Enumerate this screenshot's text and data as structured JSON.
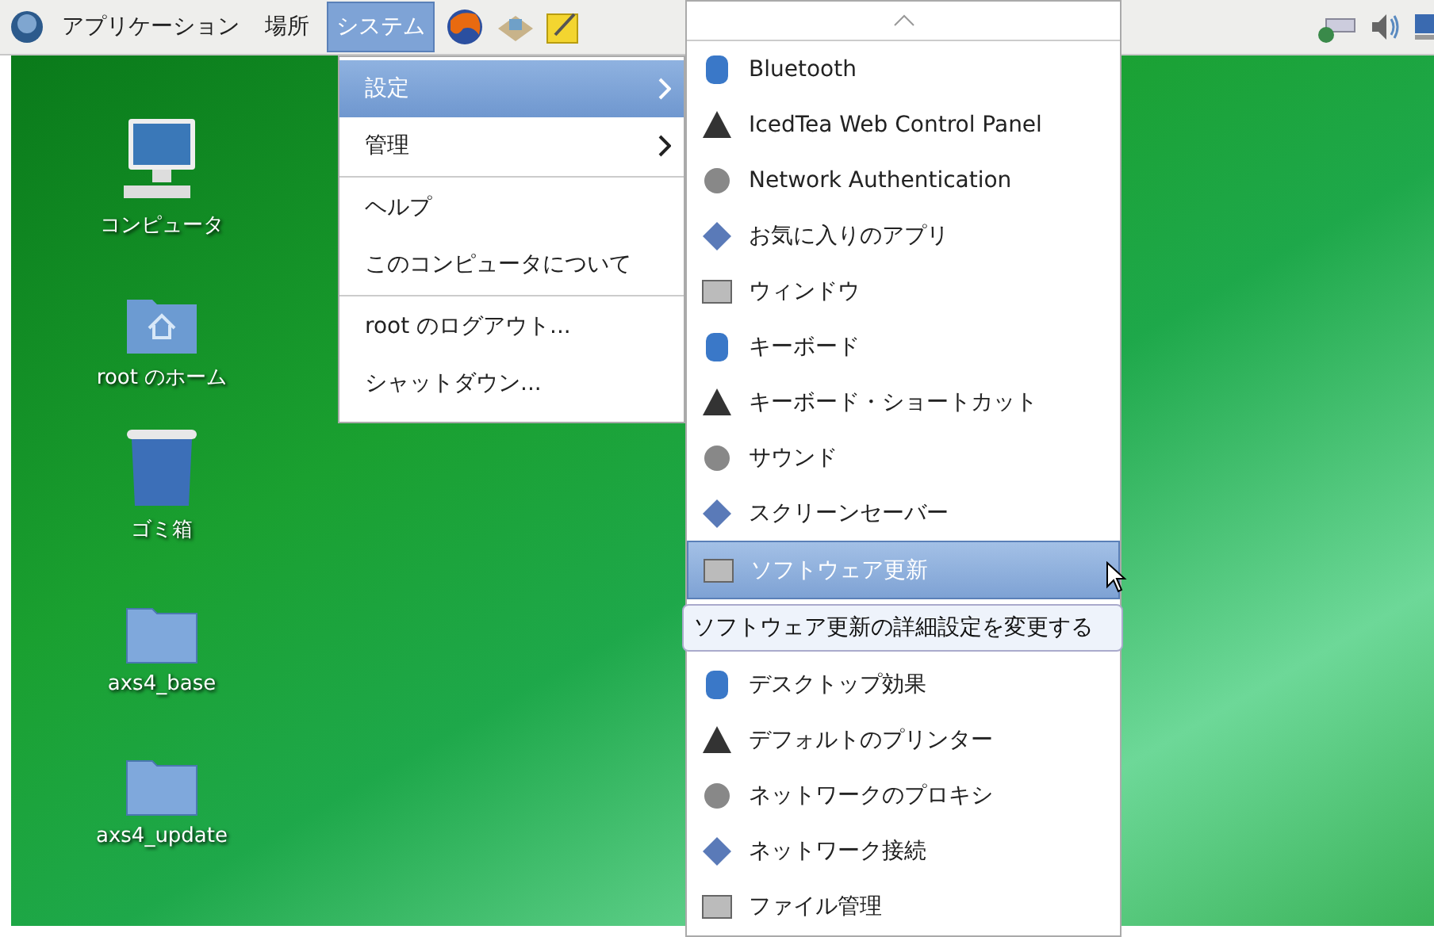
{
  "panel": {
    "menus": [
      {
        "label": "アプリケーション",
        "selected": false
      },
      {
        "label": "場所",
        "selected": false
      },
      {
        "label": "システム",
        "selected": true
      }
    ]
  },
  "desktop_icons": [
    {
      "kind": "computer",
      "label": "コンピュータ"
    },
    {
      "kind": "home",
      "label": "root のホーム"
    },
    {
      "kind": "trash",
      "label": "ゴミ箱"
    },
    {
      "kind": "folder",
      "label": "axs4_base"
    },
    {
      "kind": "folder",
      "label": "axs4_update"
    }
  ],
  "system_menu": {
    "items": [
      {
        "kind": "item",
        "label": "設定",
        "submenu": true,
        "selected": true
      },
      {
        "kind": "item",
        "label": "管理",
        "submenu": true,
        "selected": false
      },
      {
        "kind": "separator"
      },
      {
        "kind": "item",
        "label": "ヘルプ",
        "submenu": false,
        "selected": false
      },
      {
        "kind": "item",
        "label": "このコンピュータについて",
        "submenu": false,
        "selected": false
      },
      {
        "kind": "separator"
      },
      {
        "kind": "item",
        "label": "root のログアウト...",
        "submenu": false,
        "selected": false
      },
      {
        "kind": "item",
        "label": "シャットダウン...",
        "submenu": false,
        "selected": false
      }
    ]
  },
  "settings_submenu": {
    "items": [
      {
        "label": "Bluetooth",
        "selected": false
      },
      {
        "label": "IcedTea Web Control Panel",
        "selected": false
      },
      {
        "label": "Network Authentication",
        "selected": false
      },
      {
        "label": "お気に入りのアプリ",
        "selected": false
      },
      {
        "label": "ウィンドウ",
        "selected": false
      },
      {
        "label": "キーボード",
        "selected": false
      },
      {
        "label": "キーボード・ショートカット",
        "selected": false
      },
      {
        "label": "サウンド",
        "selected": false
      },
      {
        "label": "スクリーンセーバー",
        "selected": false
      },
      {
        "label": "ソフトウェア更新",
        "selected": true
      },
      {
        "label": "デスクトップ効果",
        "selected": false
      },
      {
        "label": "デフォルトのプリンター",
        "selected": false
      },
      {
        "label": "ネットワークのプロキシ",
        "selected": false
      },
      {
        "label": "ネットワーク接続",
        "selected": false
      },
      {
        "label": "ファイル管理",
        "selected": false
      }
    ],
    "tooltip": "ソフトウェア更新の詳細設定を変更する"
  }
}
